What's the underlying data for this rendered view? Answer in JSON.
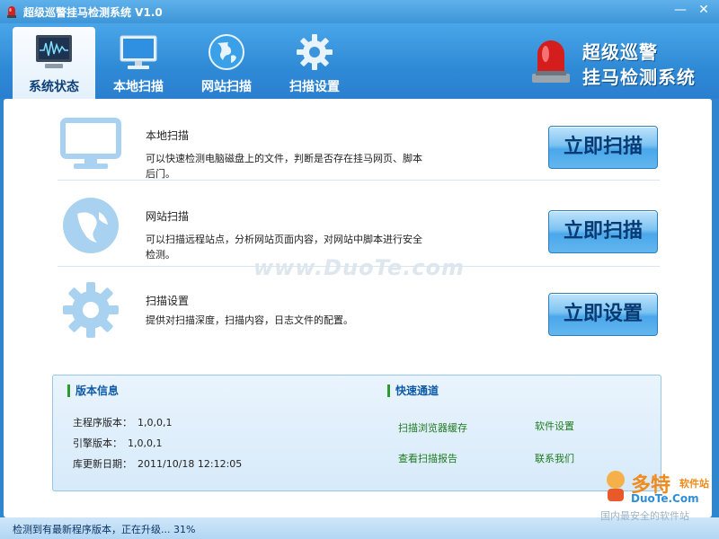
{
  "window": {
    "title": "超级巡警挂马检测系统 V1.0",
    "minimize_glyph": "—",
    "close_glyph": "✕"
  },
  "tabs": [
    {
      "label": "系统状态",
      "icon": "monitor-waveform-icon",
      "active": true
    },
    {
      "label": "本地扫描",
      "icon": "desktop-monitor-icon",
      "active": false
    },
    {
      "label": "网站扫描",
      "icon": "globe-icon",
      "active": false
    },
    {
      "label": "扫描设置",
      "icon": "gear-icon",
      "active": false
    }
  ],
  "logo": {
    "line1": "超级巡警",
    "line2": "挂马检测系统",
    "icon": "siren-icon"
  },
  "features": [
    {
      "title": "本地扫描",
      "desc": "可以快速检测电脑磁盘上的文件，判断是否存在挂马网页、脚本后门。",
      "button": "立即扫描",
      "icon": "monitor-icon"
    },
    {
      "title": "网站扫描",
      "desc": "可以扫描远程站点，分析网站页面内容，对网站中脚本进行安全检测。",
      "button": "立即扫描",
      "icon": "shield-globe-icon"
    },
    {
      "title": "扫描设置",
      "desc": "提供对扫描深度，扫描内容，日志文件的配置。",
      "button": "立即设置",
      "icon": "gear-icon"
    }
  ],
  "watermark": "www.DuoTe.com",
  "version_info": {
    "title": "版本信息",
    "rows": [
      {
        "label": "主程序版本：",
        "value": "1,0,0,1"
      },
      {
        "label": "引擎版本：",
        "value": "1,0,0,1"
      },
      {
        "label": "库更新日期：",
        "value": "2011/10/18 12:12:05"
      }
    ]
  },
  "quick_links": {
    "title": "快速通道",
    "items": [
      "扫描浏览器缓存",
      "软件设置",
      "查看扫描报告",
      "联系我们"
    ]
  },
  "status": {
    "text": "检测到有最新程序版本，正在升级... 31%"
  },
  "badge": {
    "brand": "多特",
    "brand_sub": "软件站",
    "url": "DuoTe.Com",
    "slogan": "国内最安全的软件站"
  },
  "colors": {
    "accent": "#2e86cf",
    "link": "#1f7a1f",
    "section_title": "#0e5aa7",
    "button_text": "#073a73"
  }
}
